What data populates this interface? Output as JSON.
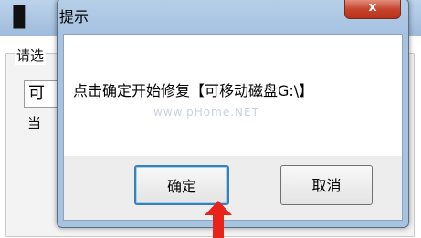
{
  "background": {
    "label": "请选",
    "input_value": "可",
    "text2": "当"
  },
  "dialog": {
    "title": "提示",
    "close_label": "x",
    "message": "点击确定开始修复【可移动磁盘G:\\】",
    "watermark": "www.pHome.NET",
    "ok_label": "确定",
    "cancel_label": "取消"
  },
  "annotation": {
    "arrow_color": "#e8231a",
    "arrow_icon": "up-arrow-icon"
  }
}
